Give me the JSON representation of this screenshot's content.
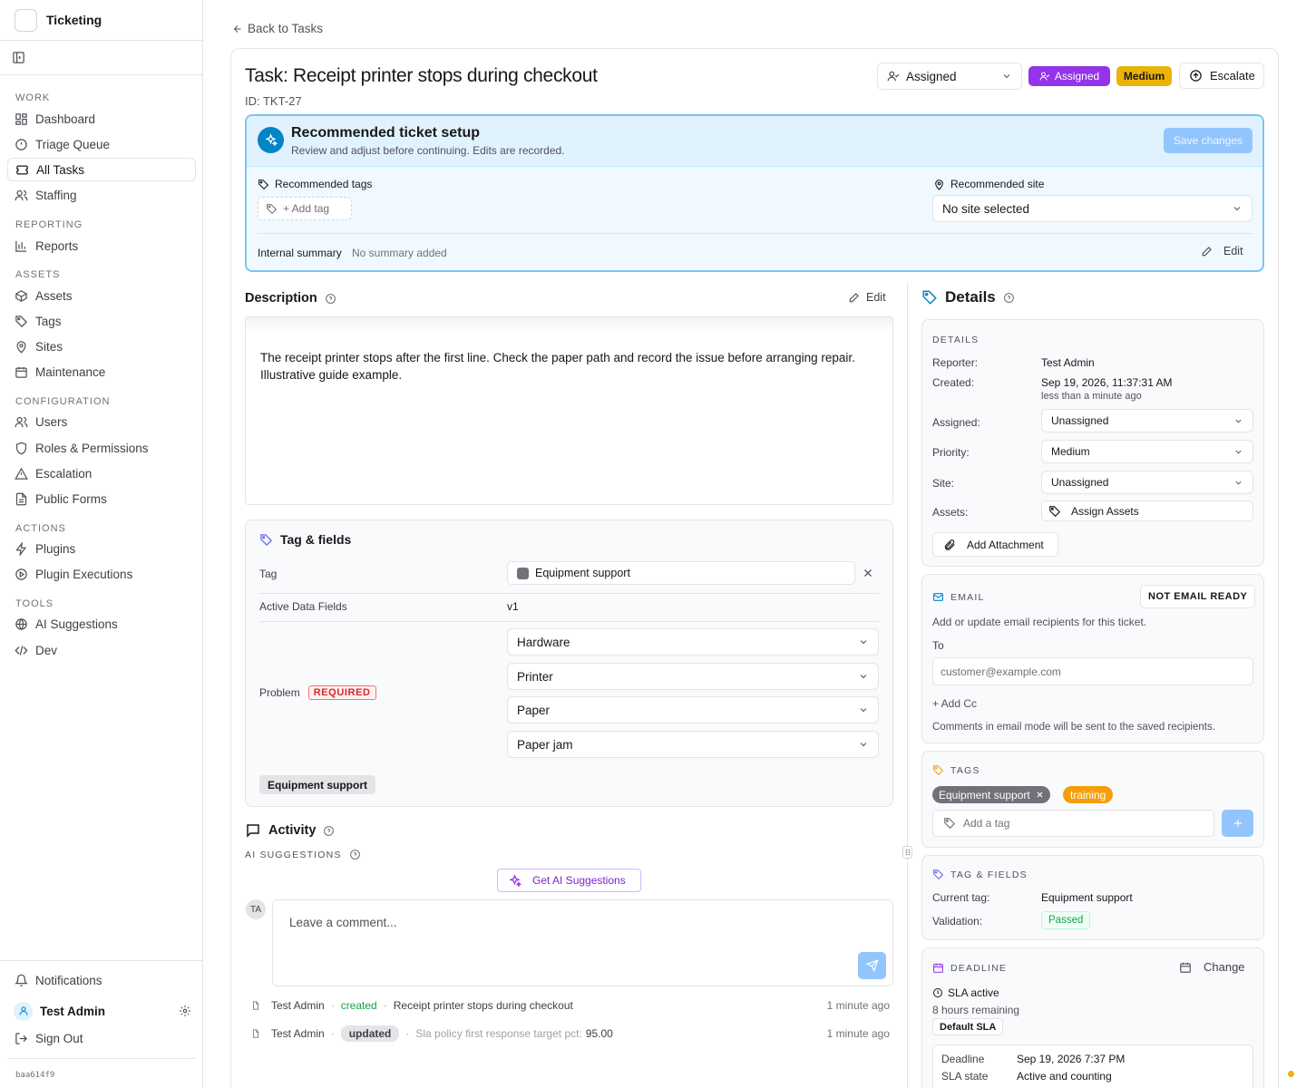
{
  "sidebar": {
    "app_name": "Ticketing",
    "sections": {
      "work": "WORK",
      "reporting": "REPORTING",
      "assets": "ASSETS",
      "configuration": "CONFIGURATION",
      "actions": "ACTIONS",
      "tools": "TOOLS"
    },
    "items": {
      "dashboard": "Dashboard",
      "triage": "Triage Queue",
      "all_tasks": "All Tasks",
      "staffing": "Staffing",
      "reports": "Reports",
      "assets": "Assets",
      "tags": "Tags",
      "sites": "Sites",
      "maintenance": "Maintenance",
      "users": "Users",
      "roles": "Roles & Permissions",
      "escalation": "Escalation",
      "public_forms": "Public Forms",
      "plugins": "Plugins",
      "plugin_executions": "Plugin Executions",
      "ai_suggestions": "AI Suggestions",
      "dev": "Dev"
    },
    "notifications": "Notifications",
    "user_name": "Test Admin",
    "sign_out": "Sign Out",
    "build": "baa614f9"
  },
  "header": {
    "back_label": "Back to Tasks",
    "title": "Task: Receipt printer stops during checkout",
    "task_id": "ID: TKT-27",
    "status_select": "Assigned",
    "status_badge": "Assigned",
    "priority_badge": "Medium",
    "escalate_label": "Escalate"
  },
  "recommendation": {
    "title": "Recommended ticket setup",
    "subtitle": "Review and adjust before continuing. Edits are recorded.",
    "save_label": "Save changes",
    "tags_label": "Recommended tags",
    "add_tag": "+ Add tag",
    "site_label": "Recommended site",
    "site_value": "No site selected",
    "summary_label": "Internal summary",
    "summary_value": "No summary added",
    "edit_label": "Edit"
  },
  "description": {
    "title": "Description",
    "edit_label": "Edit",
    "text": "The receipt printer stops after the first line. Check the paper path and record the issue before arranging repair. Illustrative guide example."
  },
  "tag_fields": {
    "title": "Tag & fields",
    "tag_label": "Tag",
    "tag_value": "Equipment support",
    "active_label": "Active Data Fields",
    "active_value": "v1",
    "problem_label": "Problem",
    "required_label": "REQUIRED",
    "problem_values": [
      "Hardware",
      "Printer",
      "Paper",
      "Paper jam"
    ],
    "footer_chip": "Equipment support"
  },
  "activity": {
    "title": "Activity",
    "ai_label": "AI SUGGESTIONS",
    "ai_button": "Get AI Suggestions",
    "avatar": "TA",
    "comment_placeholder": "Leave a comment...",
    "entries": [
      {
        "user": "Test Admin",
        "action": "created",
        "detail": "Receipt printer stops during checkout",
        "detail_value": "",
        "time": "1 minute ago"
      },
      {
        "user": "Test Admin",
        "action": "updated",
        "detail": "Sla policy first response target pct:",
        "detail_value": "95.00",
        "time": "1 minute ago"
      }
    ]
  },
  "details": {
    "title": "Details",
    "section": "DETAILS",
    "reporter_label": "Reporter:",
    "reporter": "Test Admin",
    "created_label": "Created:",
    "created": "Sep 19, 2026, 11:37:31 AM",
    "created_rel": "less than a minute ago",
    "assigned_label": "Assigned:",
    "assigned": "Unassigned",
    "priority_label": "Priority:",
    "priority": "Medium",
    "site_label": "Site:",
    "site": "Unassigned",
    "assets_label": "Assets:",
    "assets_button": "Assign Assets",
    "attachment": "Add Attachment"
  },
  "email": {
    "title": "EMAIL",
    "status": "NOT EMAIL READY",
    "desc": "Add or update email recipients for this ticket.",
    "to_label": "To",
    "to_placeholder": "customer@example.com",
    "add_cc": "+ Add Cc",
    "note": "Comments in email mode will be sent to the saved recipients."
  },
  "tags": {
    "title": "TAGS",
    "chips": [
      "Equipment support",
      "training"
    ],
    "input_placeholder": "Add a tag"
  },
  "tag_fields_side": {
    "title": "TAG & FIELDS",
    "current_label": "Current tag:",
    "current": "Equipment support",
    "validation_label": "Validation:",
    "validation": "Passed"
  },
  "deadline": {
    "title": "DEADLINE",
    "change_label": "Change",
    "sla_status": "SLA active",
    "remaining": "8 hours remaining",
    "policy": "Default SLA",
    "deadline_label": "Deadline",
    "deadline": "Sep 19, 2026 7:37 PM",
    "state_label": "SLA state",
    "state": "Active and counting"
  },
  "colors": {
    "accent_blue": "#0284c7",
    "purple": "#9333ea",
    "amber": "#eab308",
    "orange": "#f59e0b",
    "green": "#16a34a",
    "red": "#dc2626"
  }
}
